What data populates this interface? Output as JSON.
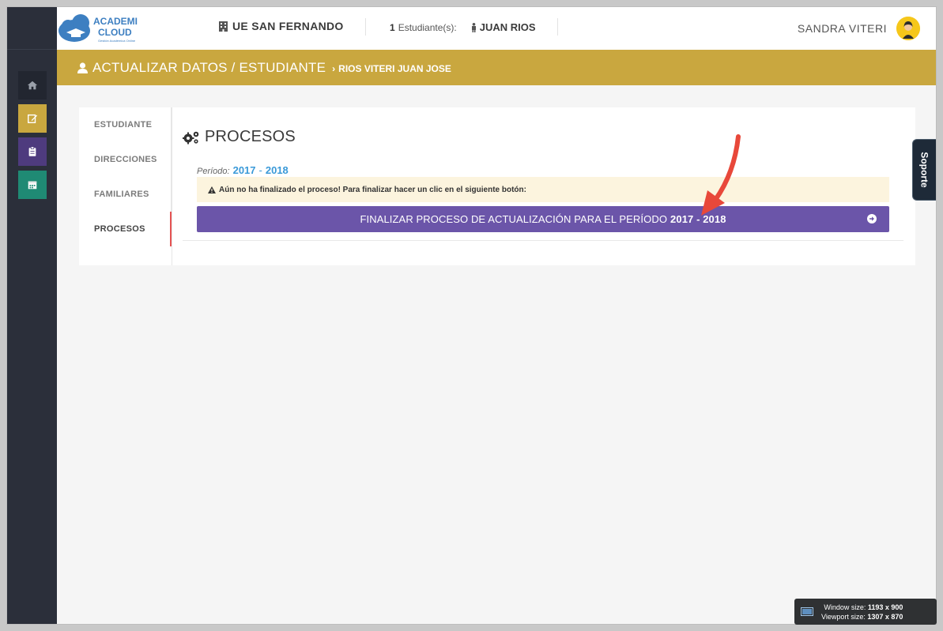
{
  "brand": {
    "line1": "ACADEMI",
    "line2": "CLOUD",
    "tagline": "Gestión Académica Online"
  },
  "header": {
    "school": "UE SAN FERNANDO",
    "students_count": "1",
    "students_label": "Estudiante(s):",
    "student_name": "JUAN RIOS",
    "user_name": "SANDRA VITERI"
  },
  "banner": {
    "title": "ACTUALIZAR DATOS / ESTUDIANTE",
    "crumb": "RIOS VITERI JUAN JOSE"
  },
  "tabs": [
    {
      "label": "ESTUDIANTE"
    },
    {
      "label": "DIRECCIONES"
    },
    {
      "label": "FAMILIARES"
    },
    {
      "label": "PROCESOS"
    }
  ],
  "pane": {
    "title": "PROCESOS",
    "period_label": "Período:",
    "period_start": "2017",
    "period_dash": "-",
    "period_end": "2018",
    "alert": "Aún no ha finalizado el proceso! Para finalizar hacer un clic en el siguiente botón:",
    "button_text": "FINALIZAR PROCESO DE ACTUALIZACIÓN PARA EL PERÍODO",
    "button_period": "2017 - 2018"
  },
  "support": {
    "label": "Soporte"
  },
  "window_size": {
    "window_label": "Window size:",
    "window_value": "1193 x 900",
    "viewport_label": "Viewport size:",
    "viewport_value": "1307 x 870"
  },
  "colors": {
    "rail": "#2b2f3a",
    "banner": "#c9a73f",
    "button": "#6b55a9",
    "accent_blue": "#3a99d8",
    "alert_bg": "#fcf4de"
  }
}
